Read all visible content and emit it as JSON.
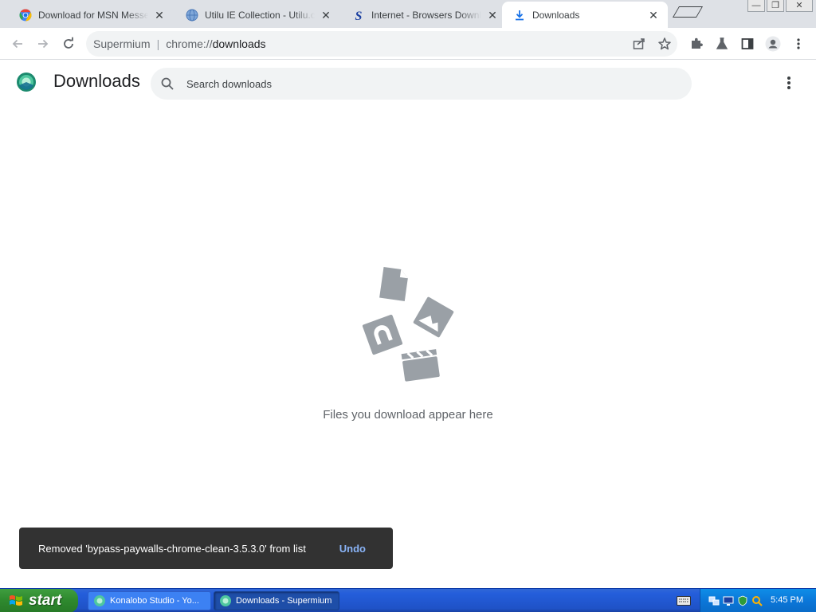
{
  "window": {
    "tabs": [
      {
        "title": "Download for MSN Messenger",
        "icon": "chromium-icon",
        "active": false
      },
      {
        "title": "Utilu IE Collection - Utilu.com",
        "icon": "globe-icon",
        "active": false
      },
      {
        "title": "Internet - Browsers Downloads",
        "icon": "s-logo-icon",
        "active": false
      },
      {
        "title": "Downloads",
        "icon": "download-icon",
        "active": true
      }
    ],
    "tab_close_glyph": "✕",
    "controls": {
      "minimize": "—",
      "restore": "❐",
      "close": "✕"
    }
  },
  "toolbar": {
    "omnibox_brand": "Supermium",
    "omnibox_divider": "|",
    "omnibox_scheme": "chrome://",
    "omnibox_path": "downloads"
  },
  "downloads": {
    "title": "Downloads",
    "search_placeholder": "Search downloads",
    "empty_text": "Files you download appear here"
  },
  "toast": {
    "message": "Removed 'bypass-paywalls-chrome-clean-3.5.3.0' from list",
    "action": "Undo"
  },
  "taskbar": {
    "start_label": "start",
    "tasks": [
      {
        "label": "Konalobo Studio - Yo...",
        "active": false
      },
      {
        "label": "Downloads - Supermium",
        "active": true
      }
    ],
    "clock": "5:45 PM"
  },
  "colors": {
    "accent_blue": "#1a73e8",
    "toast_bg": "#323232",
    "toast_action": "#8ab4f8",
    "illustration_grey": "#9aa0a6"
  }
}
